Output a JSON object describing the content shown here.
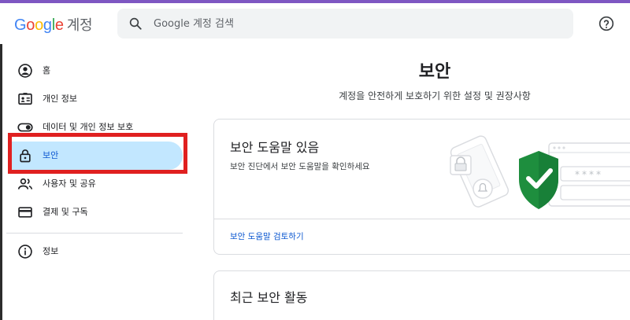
{
  "header": {
    "logo_text": "Google",
    "product_name": "계정",
    "search_placeholder": "Google 계정 검색"
  },
  "sidebar": {
    "items": [
      {
        "label": "홈",
        "icon": "account-circle-icon"
      },
      {
        "label": "개인 정보",
        "icon": "id-card-icon"
      },
      {
        "label": "데이터 및 개인 정보 보호",
        "icon": "toggle-icon"
      },
      {
        "label": "보안",
        "icon": "lock-icon",
        "active": true
      },
      {
        "label": "사용자 및 공유",
        "icon": "people-icon"
      },
      {
        "label": "결제 및 구독",
        "icon": "credit-card-icon"
      },
      {
        "label": "정보",
        "icon": "info-icon"
      }
    ]
  },
  "main": {
    "title": "보안",
    "subtitle": "계정을 안전하게 보호하기 위한 설정 및 권장사항",
    "security_card": {
      "title": "보안 도움말 있음",
      "description": "보안 진단에서 보안 도움말을 확인하세요",
      "link": "보안 도움말 검토하기",
      "password_mask": "****"
    },
    "recent_activity_card": {
      "title": "최근 보안 활동"
    }
  },
  "colors": {
    "accent_stripe": "#7e57c2",
    "active_nav_bg": "#c2e7ff",
    "link": "#0b57d0",
    "highlight_box": "#e02020",
    "shield": "#1e8e3e"
  }
}
